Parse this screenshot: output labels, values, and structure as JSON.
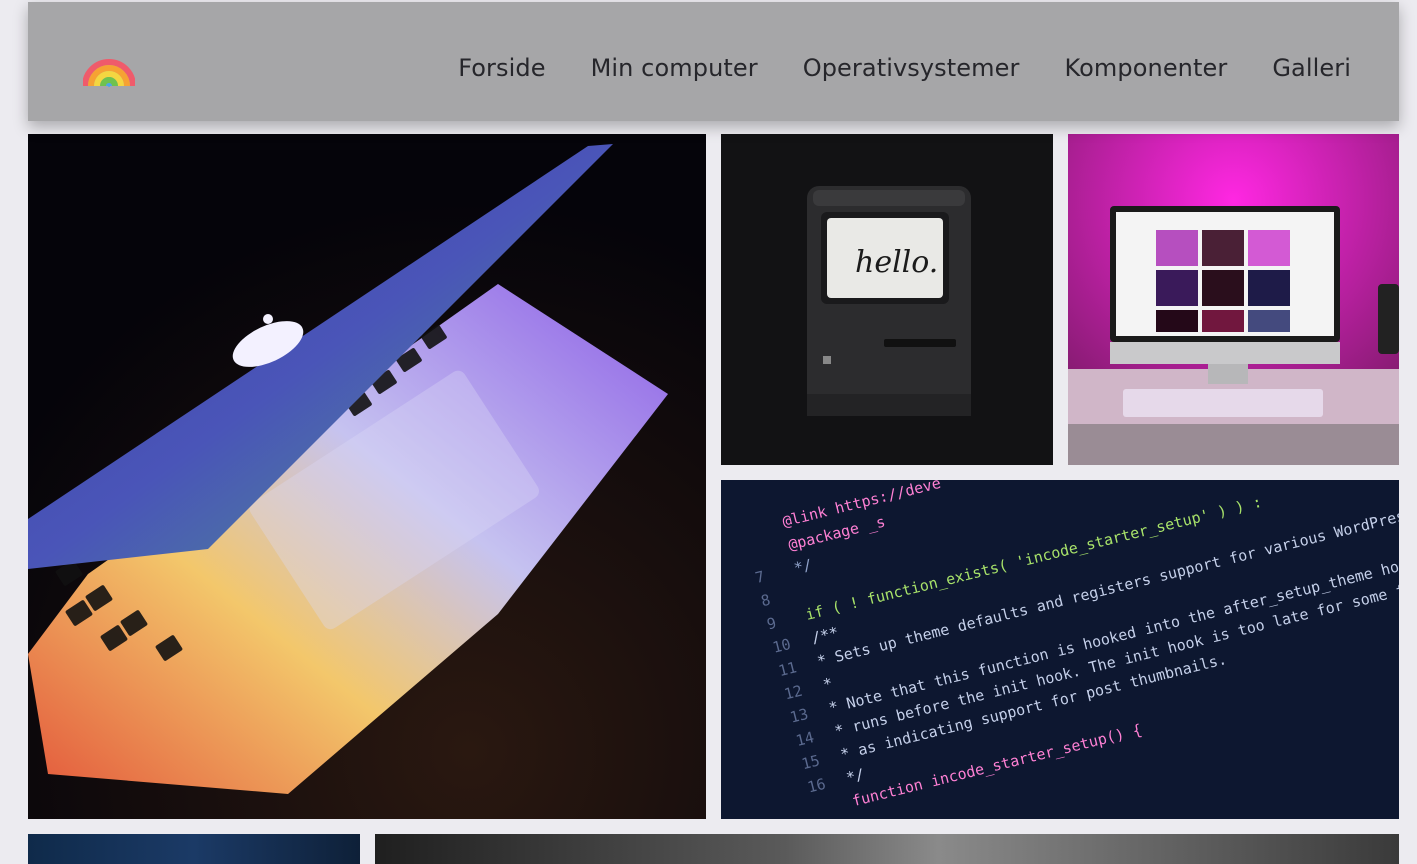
{
  "navbar": {
    "logo_icon": "rainbow-icon",
    "links": [
      "Forside",
      "Min computer",
      "Operativsystemer",
      "Komponenter",
      "Galleri"
    ]
  },
  "gallery": {
    "images": [
      {
        "subject": "laptop-photo"
      },
      {
        "subject": "retro-mac-photo",
        "screen_text": "hello."
      },
      {
        "subject": "imac-desk-photo"
      },
      {
        "subject": "code-screen-photo"
      },
      {
        "subject": "blue-photo-partial"
      },
      {
        "subject": "gray-photo-partial"
      }
    ],
    "code_lines": [
      {
        "num": "",
        "text": "@link https://deve"
      },
      {
        "num": "",
        "text": "@package _s"
      },
      {
        "num": "7",
        "text": "*/"
      },
      {
        "num": "8",
        "text": ""
      },
      {
        "num": "9",
        "text": "if ( ! function_exists( 'incode_starter_setup' ) ) :"
      },
      {
        "num": "10",
        "text": "/**"
      },
      {
        "num": "11",
        "text": " * Sets up theme defaults and registers support for various WordPress fea"
      },
      {
        "num": "12",
        "text": " *"
      },
      {
        "num": "13",
        "text": " * Note that this function is hooked into the after_setup_theme hook, which"
      },
      {
        "num": "14",
        "text": " * runs before the init hook. The init hook is too late for some features, suc"
      },
      {
        "num": "15",
        "text": " * as indicating support for post thumbnails."
      },
      {
        "num": "16",
        "text": " */"
      },
      {
        "num": "",
        "text": "function incode_starter_setup() {"
      }
    ]
  },
  "colors": {
    "navbar_bg": "#a6a6a8",
    "page_bg": "#ecebf0",
    "nav_text": "#26262b"
  }
}
